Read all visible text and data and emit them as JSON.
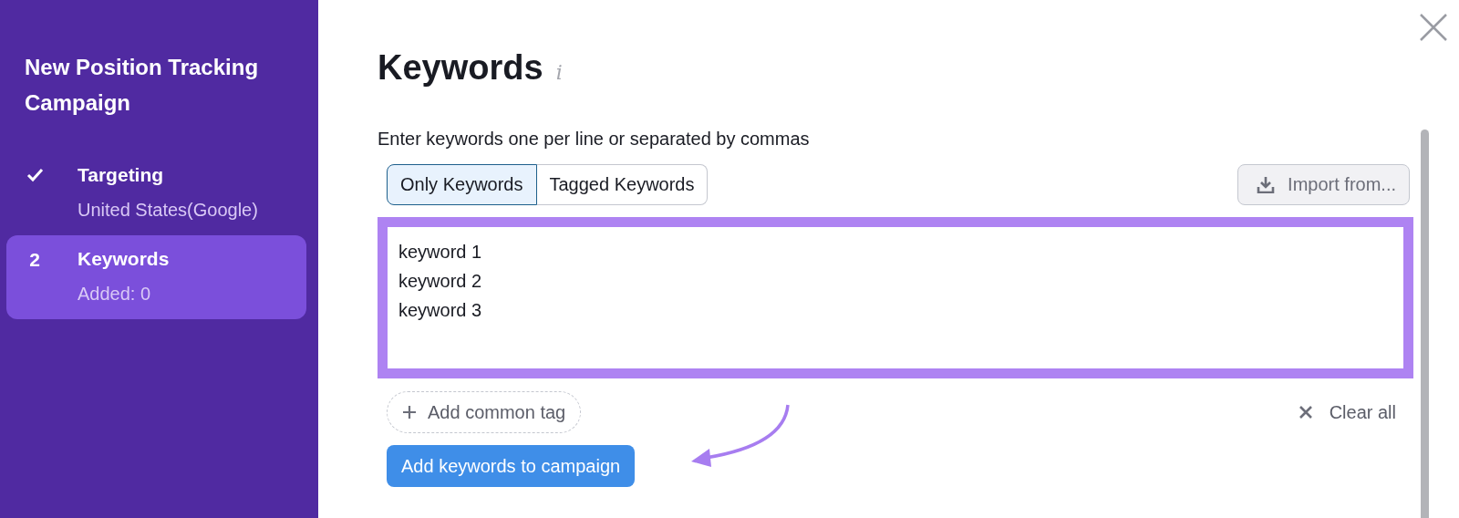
{
  "sidebar": {
    "title": "New Position Tracking Campaign",
    "steps": [
      {
        "kind": "completed",
        "label": "Targeting",
        "detail": "United States(Google)",
        "selected": false
      },
      {
        "kind": "numbered",
        "number": "2",
        "label": "Keywords",
        "detail": "Added: 0",
        "selected": true
      }
    ]
  },
  "heading": {
    "title": "Keywords",
    "info_glyph": "i"
  },
  "instructions": "Enter keywords one per line or separated by commas",
  "tabs": [
    {
      "label": "Only Keywords",
      "selected": true
    },
    {
      "label": "Tagged Keywords",
      "selected": false
    }
  ],
  "import_button": "Import from...",
  "keywords_field": {
    "lines": [
      "keyword 1",
      "keyword 2",
      "keyword 3"
    ]
  },
  "add_tag_button": "Add common tag",
  "clear_button": "Clear all",
  "submit_button": "Add keywords to campaign"
}
